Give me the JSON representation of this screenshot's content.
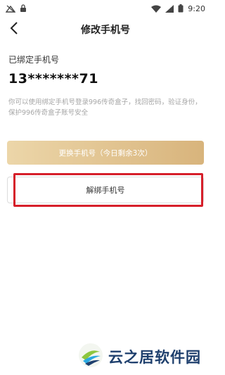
{
  "status_bar": {
    "time": "9:20",
    "icons": [
      "signal-icon",
      "lock-icon",
      "wifi-icon",
      "cellular-icon",
      "battery-icon"
    ]
  },
  "header": {
    "title": "修改手机号",
    "back_icon": "chevron-left-icon"
  },
  "content": {
    "bound_label": "已绑定手机号",
    "phone_number": "13*******71",
    "description": "你可以使用绑定手机号登录996传奇盒子，找回密码，验证身份，保护996传奇盒子账号安全"
  },
  "actions": {
    "change_label": "更换手机号（今日剩余3次）",
    "unbind_label": "解绑手机号"
  },
  "watermark": {
    "text": "云之居软件园"
  },
  "colors": {
    "highlight": "#d61f2a",
    "gold_start": "#ecd6a9",
    "gold_end": "#d8b47c"
  }
}
